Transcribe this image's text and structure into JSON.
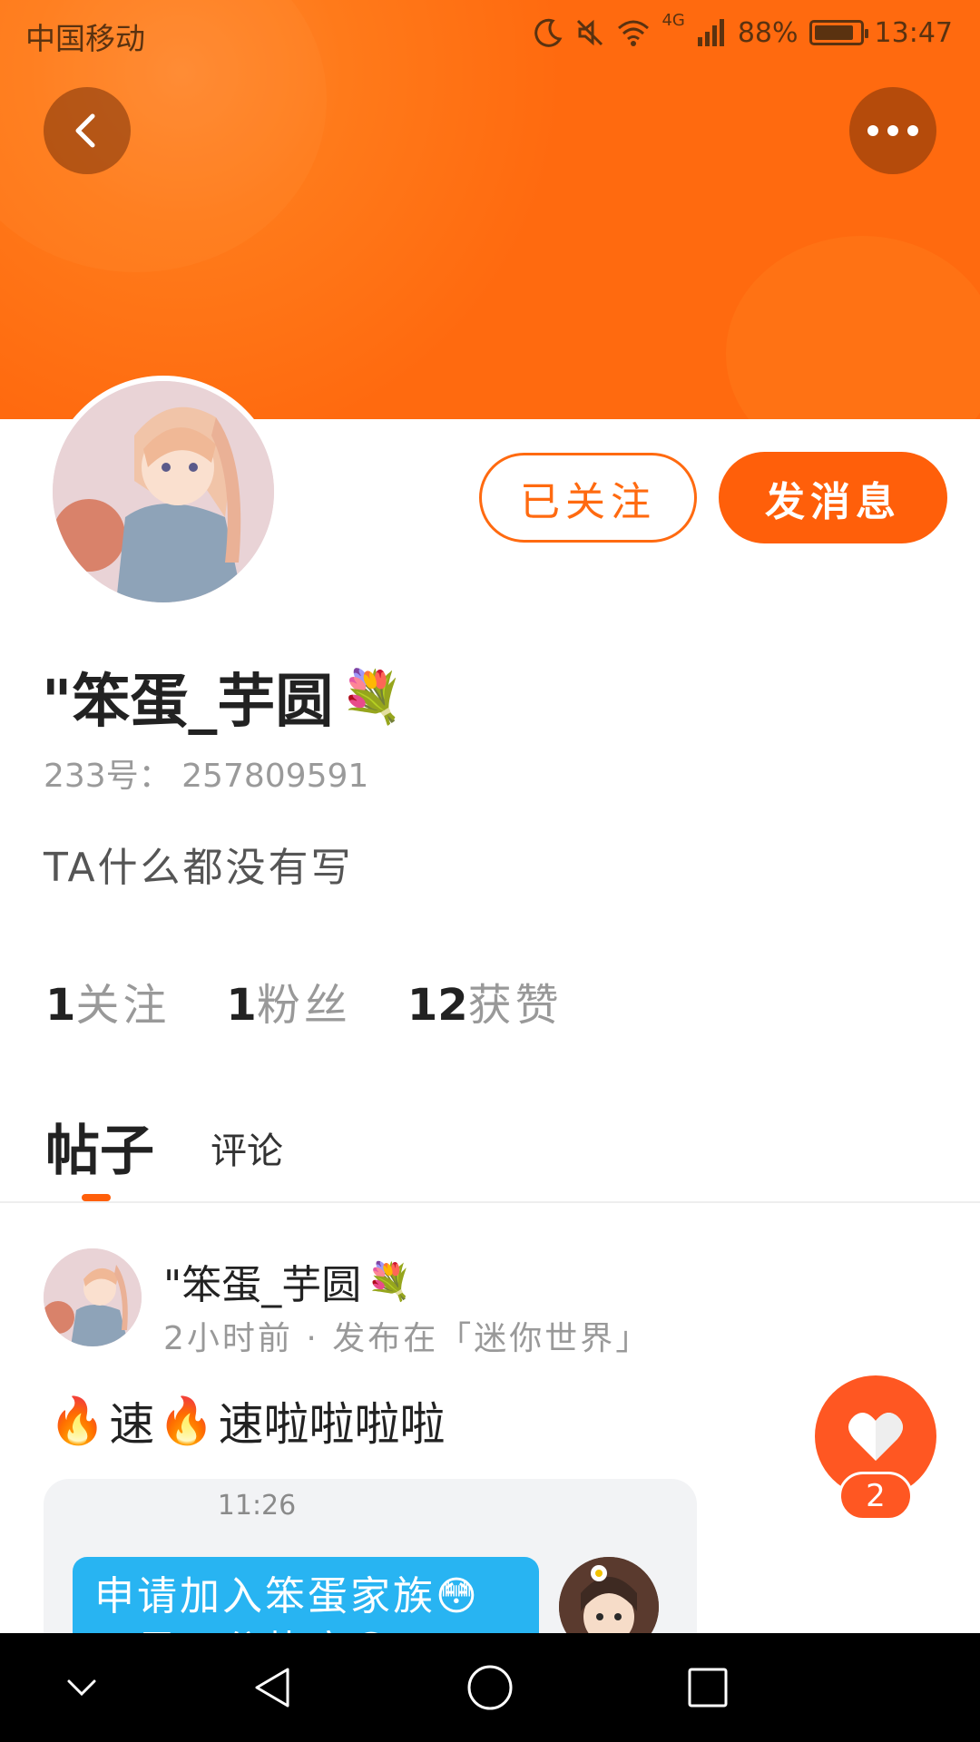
{
  "status_bar": {
    "carrier": "中国移动",
    "network": "4G",
    "battery": "88%",
    "battery_level": 0.88,
    "time": "13:47"
  },
  "header": {
    "back_icon": "chevron-left-icon",
    "more_icon": "more-dots-icon"
  },
  "profile": {
    "follow_label": "已关注",
    "message_label": "发消息",
    "username": "\"笨蛋_芋圆",
    "username_emoji": "💐",
    "id_text": "233号： 257809591",
    "bio": "TA什么都没有写",
    "stats": [
      {
        "num": "1",
        "label": "关注"
      },
      {
        "num": "1",
        "label": "粉丝"
      },
      {
        "num": "12",
        "label": "获赞"
      }
    ]
  },
  "tabs": {
    "posts": "帖子",
    "comments": "评论"
  },
  "post": {
    "author": "\"笨蛋_芋圆",
    "author_emoji": "💐",
    "meta": "2小时前 · 发布在「迷你世界」",
    "text_parts": [
      "🔥",
      "速",
      "🔥",
      "速啦啦啦啦"
    ],
    "like_count": "2",
    "image": {
      "time": "11:26",
      "bubble_line1": "申请加入笨蛋家族😳",
      "bubble_line2": "不是三分热度😳"
    }
  },
  "nav_bar": {
    "items": [
      "chevron-down-icon",
      "back-triangle-icon",
      "home-circle-icon",
      "recents-square-icon"
    ]
  },
  "colors": {
    "accent": "#ff5f0a",
    "header": "#ff6d10"
  }
}
